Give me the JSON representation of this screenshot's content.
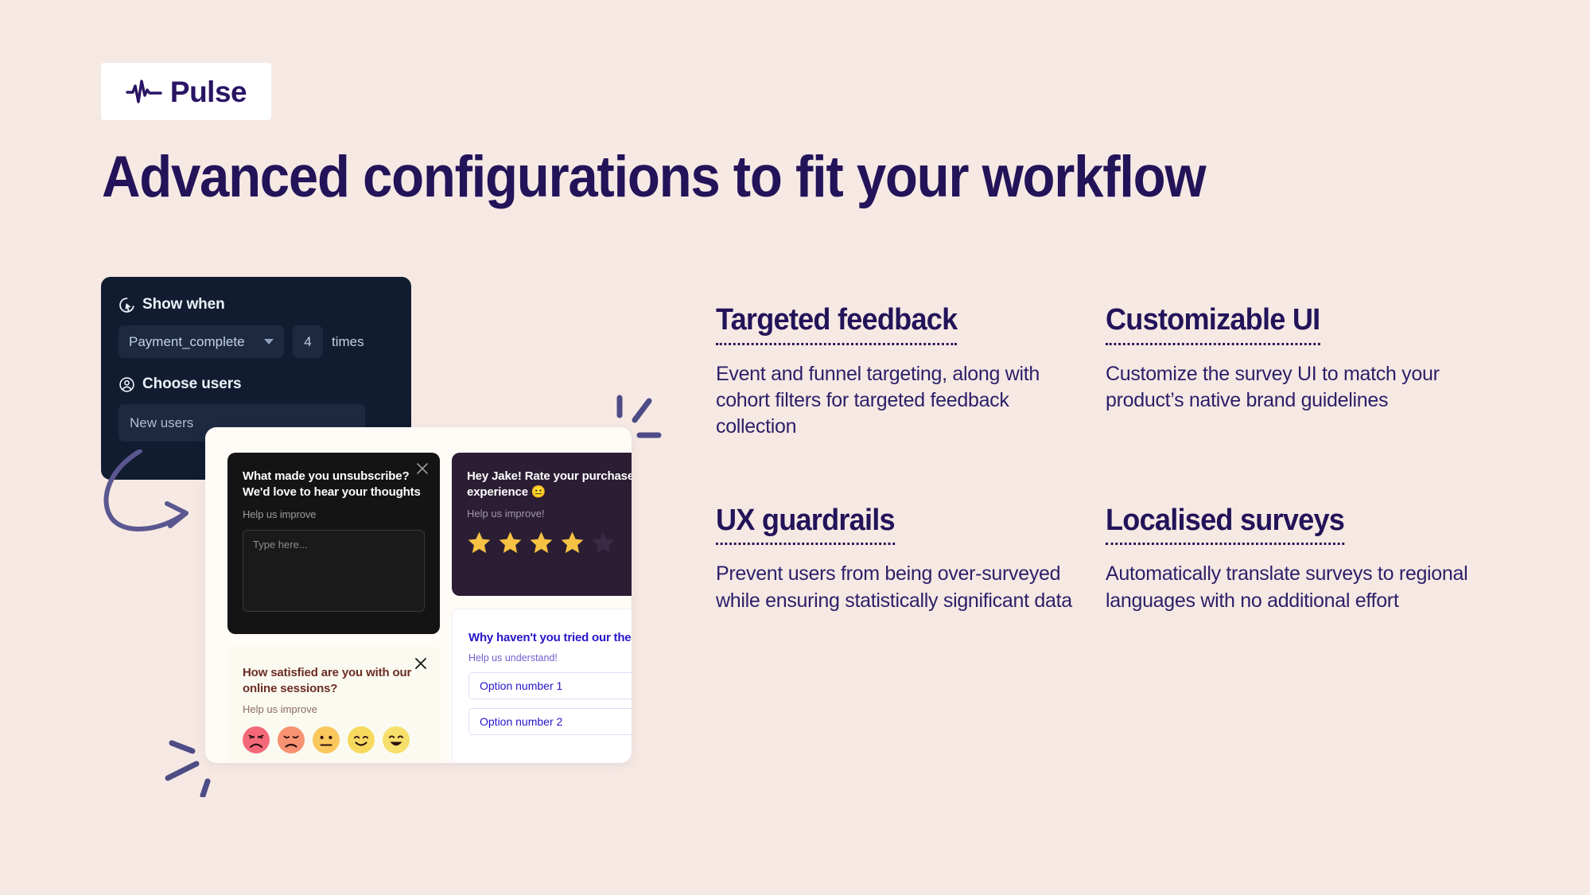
{
  "brand": {
    "name": "Pulse",
    "logo_icon": "pulse-waveform-icon",
    "color": "#2a1464"
  },
  "headline": "Advanced configurations to fit your workflow",
  "config_panel": {
    "show_when": {
      "icon": "cursor-click-icon",
      "label": "Show when",
      "event_value": "Payment_complete",
      "count_value": "4",
      "times_label": "times"
    },
    "choose_users": {
      "icon": "user-circle-icon",
      "label": "Choose users",
      "segment_value": "New users"
    }
  },
  "survey_previews": {
    "unsubscribe_card": {
      "title": "What made you unsubscribe? We'd love to hear your thoughts",
      "subtitle": "Help us improve",
      "input_placeholder": "Type here...",
      "close_icon": "close-icon"
    },
    "rating_card": {
      "title": "Hey Jake! Rate your purchase experience 😐",
      "subtitle": "Help us improve!",
      "stars_filled": 4,
      "stars_total": 5,
      "star_color": "#f5c243"
    },
    "emoji_card": {
      "title": "How satisfied are you with our online sessions?",
      "subtitle": "Help us improve",
      "close_icon": "close-icon",
      "faces": [
        {
          "name": "angry-face",
          "color": "#f4697a"
        },
        {
          "name": "sad-face",
          "color": "#f79272"
        },
        {
          "name": "neutral-face",
          "color": "#f9c75c"
        },
        {
          "name": "smile-face",
          "color": "#f7d95e"
        },
        {
          "name": "happy-face",
          "color": "#f6df6b"
        }
      ]
    },
    "options_card": {
      "title": "Why haven't you tried our the auto-save feature yet?",
      "subtitle": "Help us understand!",
      "options": [
        "Option number 1",
        "Option number 2"
      ]
    }
  },
  "features": [
    {
      "heading": "Targeted feedback",
      "body": "Event and funnel targeting, along with cohort filters for targeted feedback collection"
    },
    {
      "heading": "Customizable UI",
      "body": "Customize the survey UI to match your product’s native brand guidelines"
    },
    {
      "heading": "UX guardrails",
      "body": "Prevent users from being over-surveyed while ensuring statistically significant data"
    },
    {
      "heading": "Localised surveys",
      "body": "Automatically translate surveys to regional languages with no additional effort"
    }
  ],
  "decorations": {
    "arrow": "curved-arrow-icon",
    "sparkle_right": "sparkle-lines-icon",
    "sparkle_left": "sparkle-lines-icon"
  },
  "colors": {
    "page_bg": "#f6e9e4",
    "ink": "#231359",
    "panel_bg": "#111c30",
    "accent_purple": "#5a5790"
  }
}
